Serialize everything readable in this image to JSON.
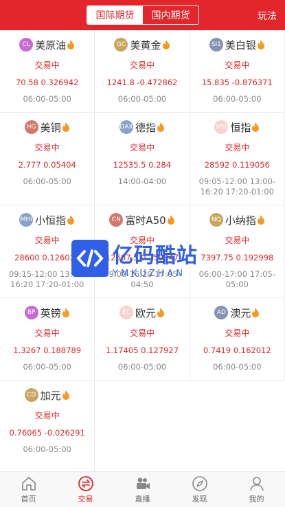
{
  "header": {
    "tabs": [
      {
        "label": "国际期货",
        "active": true
      },
      {
        "label": "国内期货",
        "active": false
      }
    ],
    "rules_label": "玩法",
    "accent_color": "#e2262b"
  },
  "products": [
    {
      "code": "CL",
      "name": "美原油",
      "status": "交易中",
      "quote": "70.58 0.326942",
      "hours": "06:00-05:00",
      "badge_color": "#c76bd6"
    },
    {
      "code": "GC",
      "name": "美黄金",
      "status": "交易中",
      "quote": "1241.8 -0.472862",
      "hours": "06:00-05:00",
      "badge_color": "#c8a660"
    },
    {
      "code": "SI1",
      "name": "美白银",
      "status": "交易中",
      "quote": "15.835 -0.876371",
      "hours": "06:00-05:00",
      "badge_color": "#8593b3"
    },
    {
      "code": "HG",
      "name": "美铜",
      "status": "交易中",
      "quote": "2.777 0.05404",
      "hours": "06:00-05:00",
      "badge_color": "#d3786c"
    },
    {
      "code": "DAX",
      "name": "德指",
      "status": "交易中",
      "quote": "12535.5 0.284",
      "hours": "14:00-04:00",
      "badge_color": "#8aa1c9"
    },
    {
      "code": "HSI",
      "name": "恒指",
      "status": "交易中",
      "quote": "28592 0.119056",
      "hours": "09:05-12:00 13:00-16:20 17:20-01:00",
      "badge_color": "#f6d2d2"
    },
    {
      "code": "MHI",
      "name": "小恒指",
      "status": "交易中",
      "quote": "28600 0.126036",
      "hours": "09:15-12:00 13:05-16:20 17:20-01:00",
      "badge_color": "#8aa1c9"
    },
    {
      "code": "CN",
      "name": "富时A50",
      "status": "交易中",
      "quote": "12607.5 0.259347",
      "hours": "09:00-16:20 17:05-04:50",
      "badge_color": "#d3786c"
    },
    {
      "code": "NQ",
      "name": "小纳指",
      "status": "交易中",
      "quote": "7397.75 0.192998",
      "hours": "06:00-17:00 17:05-05:00",
      "badge_color": "#c8a660"
    },
    {
      "code": "BP",
      "name": "英镑",
      "status": "交易中",
      "quote": "1.3267 0.188789",
      "hours": "06:00-05:00",
      "badge_color": "#c76bd6"
    },
    {
      "code": "EC",
      "name": "欧元",
      "status": "交易中",
      "quote": "1.17405 0.127927",
      "hours": "06:00-05:00",
      "badge_color": "#f6d2d2"
    },
    {
      "code": "AD",
      "name": "澳元",
      "status": "交易中",
      "quote": "0.7419 0.162012",
      "hours": "06:00-05:00",
      "badge_color": "#8593b3"
    },
    {
      "code": "CD",
      "name": "加元",
      "status": "交易中",
      "quote": "0.76065 -0.026291",
      "hours": "06:00-05:00",
      "badge_color": "#c8a660"
    }
  ],
  "watermark": {
    "brand_cn": "亿码酷站",
    "brand_en": "YMKUZHAN",
    "color": "#2f5fe8"
  },
  "tabbar": [
    {
      "label": "首页",
      "icon": "home-icon",
      "active": false
    },
    {
      "label": "交易",
      "icon": "exchange-icon",
      "active": true
    },
    {
      "label": "直播",
      "icon": "video-camera-icon",
      "active": false
    },
    {
      "label": "发现",
      "icon": "compass-icon",
      "active": false
    },
    {
      "label": "我的",
      "icon": "user-icon",
      "active": false
    }
  ]
}
